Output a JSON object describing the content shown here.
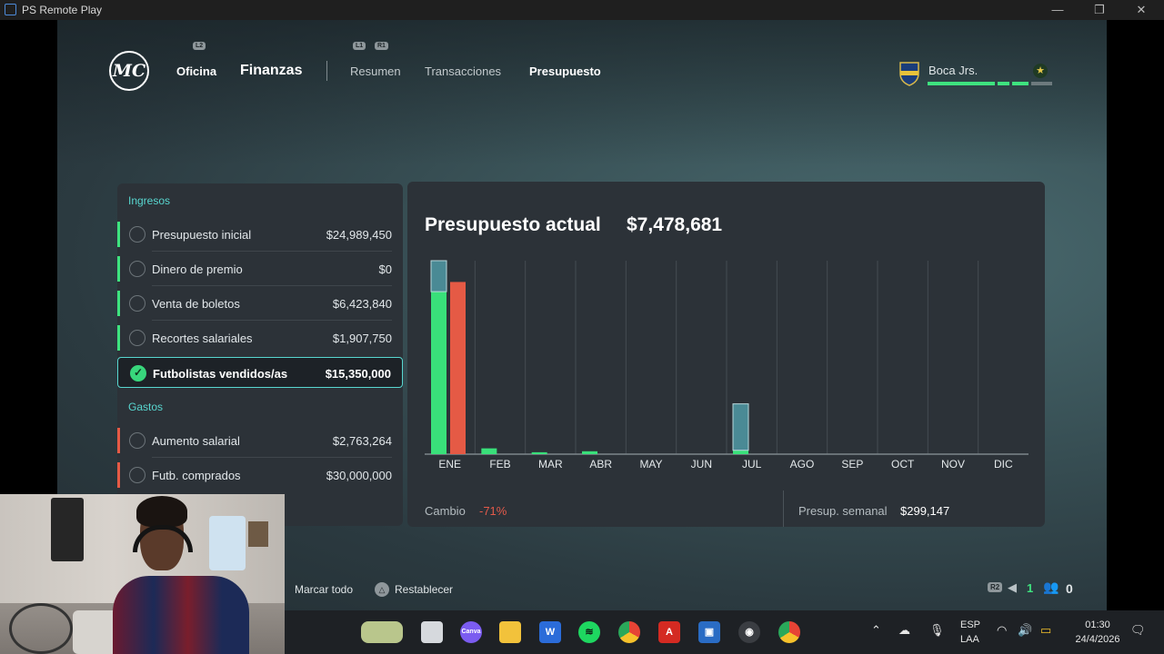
{
  "window": {
    "title": "PS Remote Play",
    "minimize": "—",
    "restore": "❐",
    "close": "✕"
  },
  "header": {
    "logo": "MC",
    "l2": "L2",
    "l1": "L1",
    "r1": "R1",
    "main_tabs": [
      "Oficina",
      "Finanzas"
    ],
    "sub_tabs": [
      "Resumen",
      "Transacciones",
      "Presupuesto"
    ],
    "active_sub_tab": "Presupuesto",
    "club_name": "Boca Jrs."
  },
  "ingresos": {
    "heading": "Ingresos",
    "items": [
      {
        "label": "Presupuesto inicial",
        "value": "$24,989,450"
      },
      {
        "label": "Dinero de premio",
        "value": "$0"
      },
      {
        "label": "Venta de boletos",
        "value": "$6,423,840"
      },
      {
        "label": "Recortes salariales",
        "value": "$1,907,750"
      },
      {
        "label": "Futbolistas vendidos/as",
        "value": "$15,350,000",
        "selected": true
      }
    ]
  },
  "gastos": {
    "heading": "Gastos",
    "items": [
      {
        "label": "Aumento salarial",
        "value": "$2,763,264"
      },
      {
        "label": "Futb. comprados",
        "value": "$30,000,000"
      }
    ]
  },
  "summary": {
    "title": "Presupuesto actual",
    "total": "$7,478,681",
    "change_label": "Cambio",
    "change_value": "-71%",
    "weekly_label": "Presup. semanal",
    "weekly_value": "$299,147"
  },
  "chart_data": {
    "type": "bar",
    "categories": [
      "ENE",
      "FEB",
      "MAR",
      "ABR",
      "MAY",
      "JUN",
      "JUL",
      "AGO",
      "SEP",
      "OCT",
      "NOV",
      "DIC"
    ],
    "series": [
      {
        "color": "#39e07a",
        "values": [
          84,
          3,
          1,
          1.5,
          0,
          0,
          2,
          0,
          0,
          0,
          0,
          0
        ]
      },
      {
        "color": "#4a8a95",
        "values": [
          16,
          0,
          0,
          0,
          0,
          0,
          24,
          0,
          0,
          0,
          0,
          0
        ]
      },
      {
        "color": "#e55a45",
        "values": [
          89,
          0,
          0,
          0,
          0,
          0,
          0,
          0,
          0,
          0,
          0,
          0
        ]
      }
    ],
    "ylim": [
      0,
      100
    ],
    "grid": true
  },
  "bottom_hints": {
    "mark_all": "Marcar todo",
    "reset": "Restablecer",
    "r2": "R2",
    "count_a": "1",
    "count_b": "0"
  },
  "taskbar": {
    "language": "ESP",
    "layout": "LAA",
    "time": "01:30",
    "date": "24/4/2026",
    "apps": [
      "file-explorer-icon",
      "canva-icon",
      "folder-icon",
      "word-icon",
      "spotify-icon",
      "chrome-icon",
      "acrobat-icon",
      "remote-play-icon",
      "obs-icon",
      "chrome-icon"
    ]
  }
}
